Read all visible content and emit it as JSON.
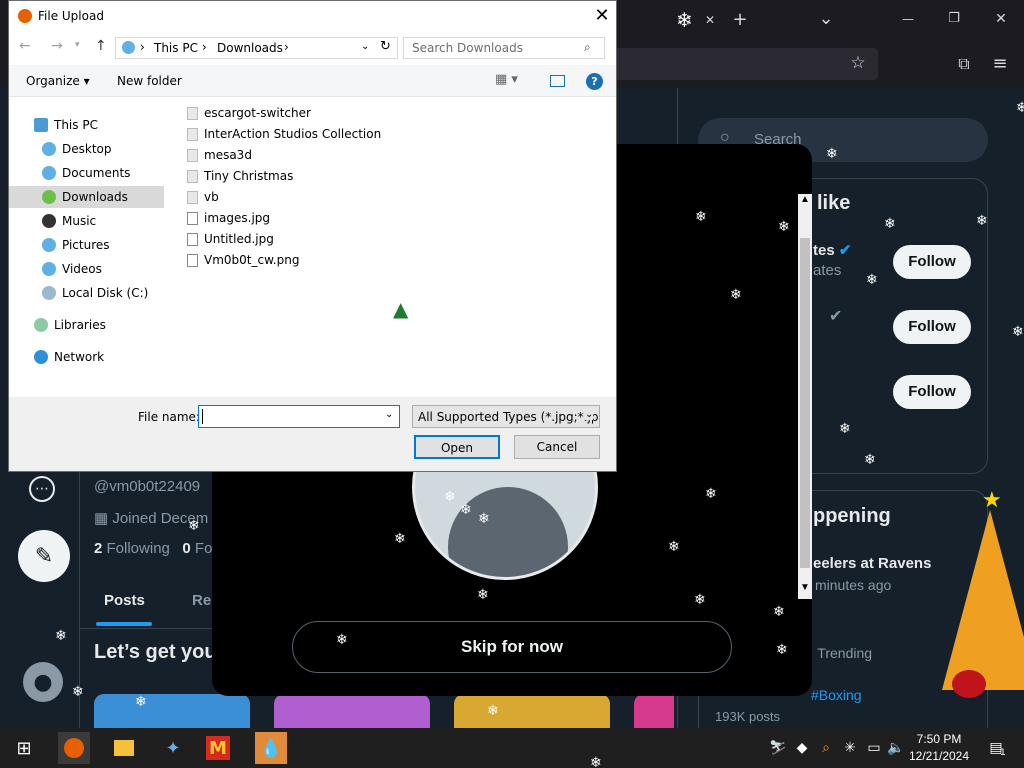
{
  "browser": {
    "new_tab_symbol": "+",
    "dropdown_symbol": "⌄",
    "window_controls": {
      "minimize": "—",
      "maximize": "❐",
      "close": "✕"
    },
    "bookmark_symbol": "☆",
    "extensions_symbol": "⧉",
    "menu_symbol": "≡",
    "tab_close_symbol": "✕"
  },
  "x_page": {
    "search_placeholder": "Search",
    "handle": "@vm0b0t22409",
    "joined": "Joined Decem",
    "following_count": "2",
    "following_label": "Following",
    "followers_count": "0",
    "followers_label": "Fo",
    "tabs": [
      {
        "label": "Posts"
      },
      {
        "label": "Re"
      }
    ],
    "started_text": "Let’s get you",
    "who_to_follow_title": "like",
    "who_to_follow_names": [
      "tes",
      "ates"
    ],
    "follow_label": "Follow",
    "happening_title": "ppening",
    "trend_title": "eelers at Ravens",
    "trend_time": "minutes ago",
    "trending_label": "· Trending",
    "trend_tag": "#Boxing",
    "trend_posts": "193K posts"
  },
  "modal": {
    "skip_label": "Skip for now"
  },
  "file_dialog": {
    "title": "File Upload",
    "close_symbol": "✕",
    "breadcrumb": [
      "This PC",
      "Downloads"
    ],
    "breadcrumb_sep": "›",
    "search_placeholder": "Search Downloads",
    "organize_label": "Organize ▾",
    "new_folder_label": "New folder",
    "help_symbol": "?",
    "nav_tree": [
      {
        "label": "This PC",
        "icon": "pc-icon"
      },
      {
        "label": "Desktop",
        "icon": "desktop-icon"
      },
      {
        "label": "Documents",
        "icon": "documents-icon"
      },
      {
        "label": "Downloads",
        "icon": "downloads-icon"
      },
      {
        "label": "Music",
        "icon": "music-icon"
      },
      {
        "label": "Pictures",
        "icon": "pictures-icon"
      },
      {
        "label": "Videos",
        "icon": "videos-icon"
      },
      {
        "label": "Local Disk (C:)",
        "icon": "disk-icon"
      },
      {
        "label": "Libraries",
        "icon": "libraries-icon"
      },
      {
        "label": "Network",
        "icon": "network-icon"
      }
    ],
    "files": [
      {
        "name": "escargot-switcher",
        "kind": "folder"
      },
      {
        "name": "InterAction Studios Collection",
        "kind": "folder"
      },
      {
        "name": "mesa3d",
        "kind": "folder"
      },
      {
        "name": "Tiny Christmas",
        "kind": "folder"
      },
      {
        "name": "vb",
        "kind": "folder"
      },
      {
        "name": "images.jpg",
        "kind": "image"
      },
      {
        "name": "Untitled.jpg",
        "kind": "image"
      },
      {
        "name": "Vm0b0t_cw.png",
        "kind": "image"
      }
    ],
    "filename_label": "File name:",
    "filename_value": "",
    "filetype_value": "All Supported Types (*.jpg;*.jpe",
    "open_label": "Open",
    "cancel_label": "Cancel"
  },
  "taskbar": {
    "time": "7:50 PM",
    "date": "12/21/2024",
    "notification_count": "1"
  },
  "colors": {
    "x_background": "#15202b",
    "dialog_selection": "#cce8ff",
    "accent_blue": "#0078d7",
    "taskbar": "#1f1f1f"
  }
}
